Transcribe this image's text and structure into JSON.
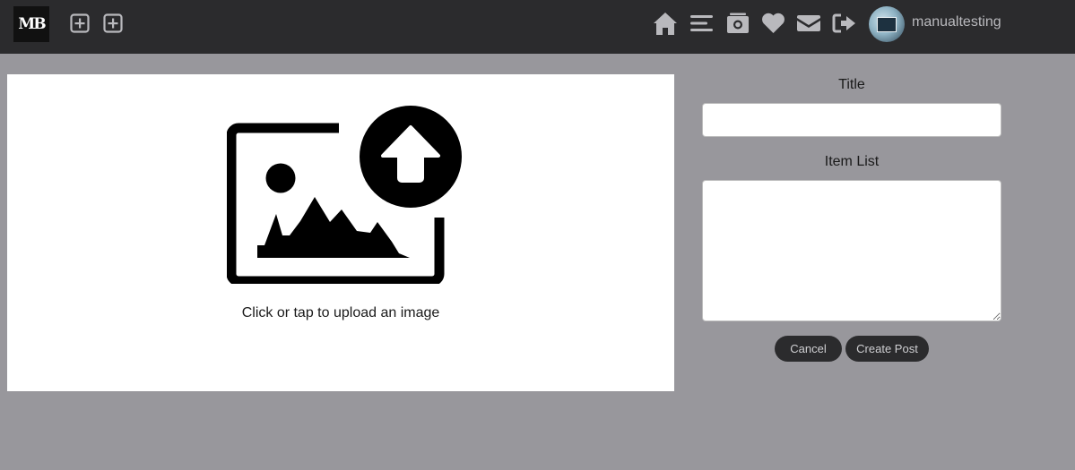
{
  "header": {
    "logo_text": "MB",
    "username": "manualtesting",
    "add_buttons": [
      "add-post-icon",
      "add-item-icon"
    ],
    "nav_icons": [
      "home-icon",
      "menu-icon",
      "camera-icon",
      "heart-icon",
      "envelope-icon",
      "sign-out-icon"
    ]
  },
  "upload": {
    "prompt": "Click or tap to upload an image",
    "icon": "image-upload-icon"
  },
  "form": {
    "title_label": "Title",
    "title_value": "",
    "item_list_label": "Item List",
    "item_list_value": "",
    "cancel_label": "Cancel",
    "create_label": "Create Post"
  },
  "colors": {
    "topbar": "#2b2b2d",
    "background": "#98979c",
    "panel": "#ffffff",
    "button": "#2b2b2d",
    "icon": "#b9b9bd"
  }
}
